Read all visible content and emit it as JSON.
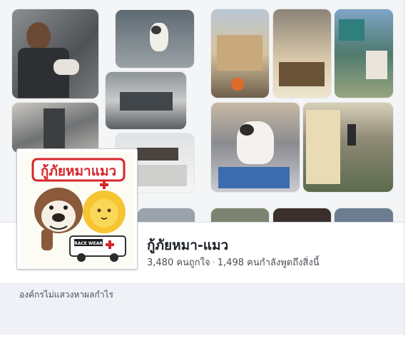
{
  "page": {
    "name": "กู้ภัยหมา-แมว",
    "likes_text": "3,480 คนถูกใจ",
    "separator": "·",
    "talking_text": "1,498 คนกำลังพูดถึงสิ่งนี้",
    "about": "องค์กรไม่แสวงหาผลกำไร"
  },
  "profile_logo": {
    "title": "กู้ภัยหมาแมว",
    "ambulance_text": "RACE WEAR"
  },
  "cover_photos": [
    "man-holding-cat-photo",
    "cat-on-ledge-photo",
    "building-gap-photo",
    "window-ledge-photo",
    "sign-board-photo",
    "shophouse-street-photo",
    "balcony-rescue-photo",
    "building-facade-photo",
    "rescued-cat-photo",
    "rescuers-on-wall-photo",
    "bottom-strip-photo-1",
    "bottom-strip-photo-2",
    "bottom-strip-photo-3",
    "bottom-strip-photo-4"
  ],
  "colors": {
    "name": "#1d2129",
    "stats": "#4b4f56",
    "about_bg": "#f0f1f6",
    "logo_red": "#d8252b",
    "logo_yellow": "#f6c531",
    "logo_brown": "#8a5a3b"
  }
}
